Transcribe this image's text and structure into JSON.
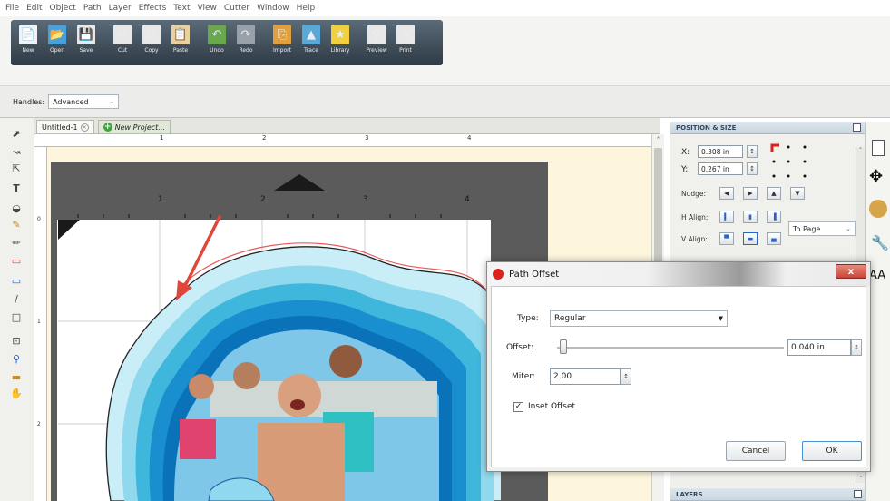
{
  "menu": [
    "File",
    "Edit",
    "Object",
    "Path",
    "Layer",
    "Effects",
    "Text",
    "View",
    "Cutter",
    "Window",
    "Help"
  ],
  "toolbar": [
    {
      "label": "New",
      "icon": "new-icon"
    },
    {
      "label": "Open",
      "icon": "open-icon"
    },
    {
      "label": "Save",
      "icon": "save-icon"
    },
    {
      "label": "Cut",
      "icon": "cut-icon"
    },
    {
      "label": "Copy",
      "icon": "copy-icon"
    },
    {
      "label": "Paste",
      "icon": "paste-icon"
    },
    {
      "label": "Undo",
      "icon": "undo-icon"
    },
    {
      "label": "Redo",
      "icon": "redo-icon"
    },
    {
      "label": "Import",
      "icon": "import-icon"
    },
    {
      "label": "Trace",
      "icon": "trace-icon"
    },
    {
      "label": "Library",
      "icon": "library-icon"
    },
    {
      "label": "Preview",
      "icon": "preview-icon"
    },
    {
      "label": "Print",
      "icon": "print-icon"
    }
  ],
  "handles": {
    "label": "Handles:",
    "value": "Advanced"
  },
  "tabs": {
    "doc": "Untitled-1",
    "new_project": "New Project..."
  },
  "ruler": {
    "top": [
      "1",
      "2",
      "3",
      "4"
    ],
    "mat": [
      "1",
      "2",
      "3",
      "4"
    ],
    "left": [
      "0",
      "1",
      "2"
    ]
  },
  "position_size": {
    "title": "POSITION & SIZE",
    "x_label": "X:",
    "x_value": "0.308 in",
    "y_label": "Y:",
    "y_value": "0.267 in",
    "nudge_label": "Nudge:",
    "halign_label": "H Align:",
    "valign_label": "V Align:",
    "align_to": "To Page"
  },
  "layers": {
    "title": "LAYERS"
  },
  "dialog": {
    "title": "Path Offset",
    "type_label": "Type:",
    "type_value": "Regular",
    "offset_label": "Offset:",
    "offset_value": "0.040 in",
    "offset_slider_fraction": 0.01,
    "miter_label": "Miter:",
    "miter_value": "2.00",
    "inset_label": "Inset Offset",
    "inset_checked": true,
    "cancel_label": "Cancel",
    "ok_label": "OK",
    "close_label": "x"
  },
  "right_strip_label": "AA",
  "colors": {
    "accent_red": "#e0463a",
    "mat": "#5b5b5b",
    "canvas_bg": "#fdf6dd",
    "panel_header": "#c9d5df",
    "wave_light": "#a8e0ef",
    "wave_mid": "#3fb6dc",
    "wave_dark": "#0a72b8",
    "cut_line": "#e85a5a"
  }
}
